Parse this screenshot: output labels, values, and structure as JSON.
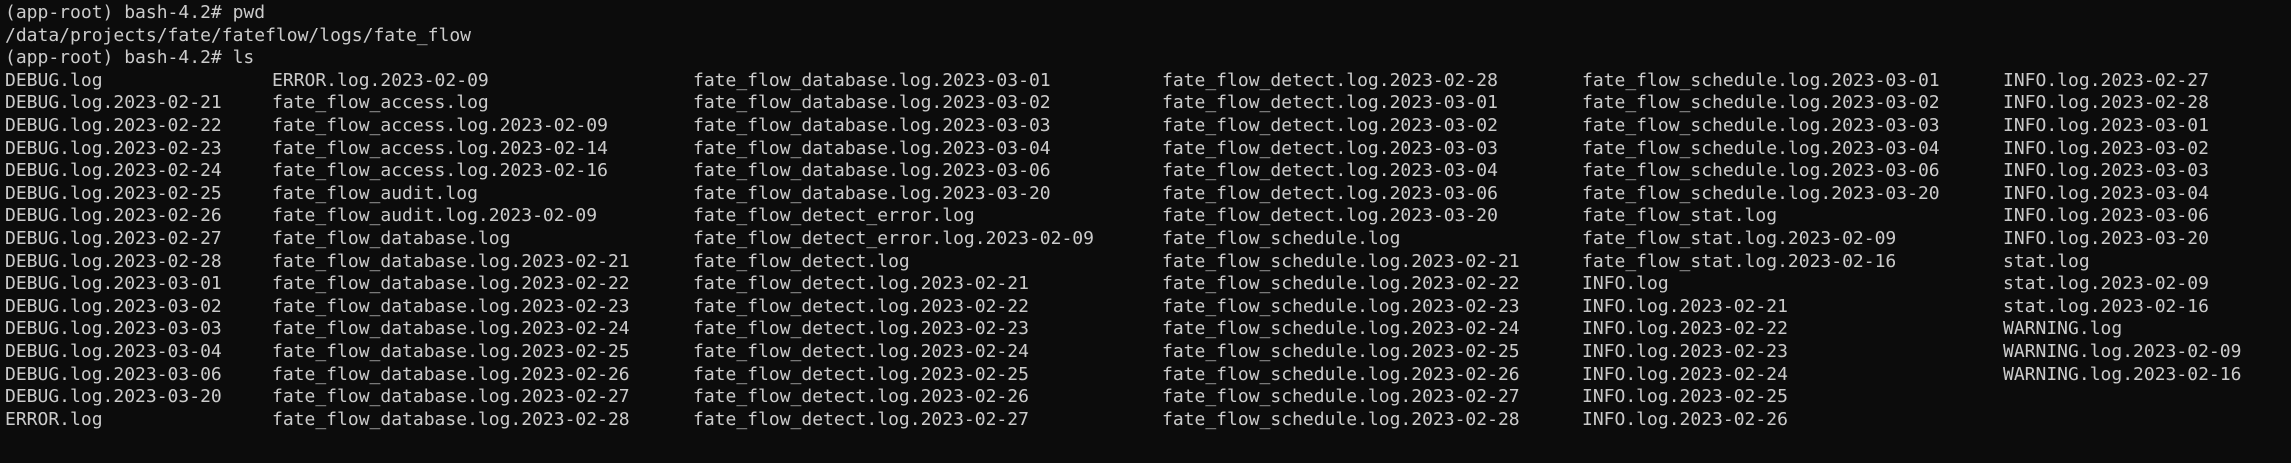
{
  "terminal": {
    "lines": [
      "(app-root) bash-4.2# pwd",
      "/data/projects/fate/fateflow/logs/fate_flow",
      "(app-root) bash-4.2# ls"
    ],
    "ls_rows": [
      [
        "DEBUG.log",
        "ERROR.log.2023-02-09",
        "fate_flow_database.log.2023-03-01",
        "fate_flow_detect.log.2023-02-28",
        "fate_flow_schedule.log.2023-03-01",
        "INFO.log.2023-02-27"
      ],
      [
        "DEBUG.log.2023-02-21",
        "fate_flow_access.log",
        "fate_flow_database.log.2023-03-02",
        "fate_flow_detect.log.2023-03-01",
        "fate_flow_schedule.log.2023-03-02",
        "INFO.log.2023-02-28"
      ],
      [
        "DEBUG.log.2023-02-22",
        "fate_flow_access.log.2023-02-09",
        "fate_flow_database.log.2023-03-03",
        "fate_flow_detect.log.2023-03-02",
        "fate_flow_schedule.log.2023-03-03",
        "INFO.log.2023-03-01"
      ],
      [
        "DEBUG.log.2023-02-23",
        "fate_flow_access.log.2023-02-14",
        "fate_flow_database.log.2023-03-04",
        "fate_flow_detect.log.2023-03-03",
        "fate_flow_schedule.log.2023-03-04",
        "INFO.log.2023-03-02"
      ],
      [
        "DEBUG.log.2023-02-24",
        "fate_flow_access.log.2023-02-16",
        "fate_flow_database.log.2023-03-06",
        "fate_flow_detect.log.2023-03-04",
        "fate_flow_schedule.log.2023-03-06",
        "INFO.log.2023-03-03"
      ],
      [
        "DEBUG.log.2023-02-25",
        "fate_flow_audit.log",
        "fate_flow_database.log.2023-03-20",
        "fate_flow_detect.log.2023-03-06",
        "fate_flow_schedule.log.2023-03-20",
        "INFO.log.2023-03-04"
      ],
      [
        "DEBUG.log.2023-02-26",
        "fate_flow_audit.log.2023-02-09",
        "fate_flow_detect_error.log",
        "fate_flow_detect.log.2023-03-20",
        "fate_flow_stat.log",
        "INFO.log.2023-03-06"
      ],
      [
        "DEBUG.log.2023-02-27",
        "fate_flow_database.log",
        "fate_flow_detect_error.log.2023-02-09",
        "fate_flow_schedule.log",
        "fate_flow_stat.log.2023-02-09",
        "INFO.log.2023-03-20"
      ],
      [
        "DEBUG.log.2023-02-28",
        "fate_flow_database.log.2023-02-21",
        "fate_flow_detect.log",
        "fate_flow_schedule.log.2023-02-21",
        "fate_flow_stat.log.2023-02-16",
        "stat.log"
      ],
      [
        "DEBUG.log.2023-03-01",
        "fate_flow_database.log.2023-02-22",
        "fate_flow_detect.log.2023-02-21",
        "fate_flow_schedule.log.2023-02-22",
        "INFO.log",
        "stat.log.2023-02-09"
      ],
      [
        "DEBUG.log.2023-03-02",
        "fate_flow_database.log.2023-02-23",
        "fate_flow_detect.log.2023-02-22",
        "fate_flow_schedule.log.2023-02-23",
        "INFO.log.2023-02-21",
        "stat.log.2023-02-16"
      ],
      [
        "DEBUG.log.2023-03-03",
        "fate_flow_database.log.2023-02-24",
        "fate_flow_detect.log.2023-02-23",
        "fate_flow_schedule.log.2023-02-24",
        "INFO.log.2023-02-22",
        "WARNING.log"
      ],
      [
        "DEBUG.log.2023-03-04",
        "fate_flow_database.log.2023-02-25",
        "fate_flow_detect.log.2023-02-24",
        "fate_flow_schedule.log.2023-02-25",
        "INFO.log.2023-02-23",
        "WARNING.log.2023-02-09"
      ],
      [
        "DEBUG.log.2023-03-06",
        "fate_flow_database.log.2023-02-26",
        "fate_flow_detect.log.2023-02-25",
        "fate_flow_schedule.log.2023-02-26",
        "INFO.log.2023-02-24",
        "WARNING.log.2023-02-16"
      ],
      [
        "DEBUG.log.2023-03-20",
        "fate_flow_database.log.2023-02-27",
        "fate_flow_detect.log.2023-02-26",
        "fate_flow_schedule.log.2023-02-27",
        "INFO.log.2023-02-25",
        ""
      ],
      [
        "ERROR.log",
        "fate_flow_database.log.2023-02-28",
        "fate_flow_detect.log.2023-02-27",
        "fate_flow_schedule.log.2023-02-28",
        "INFO.log.2023-02-26",
        ""
      ]
    ]
  },
  "colors": {
    "background": "#0c0c0c",
    "foreground": "#cccccc"
  }
}
